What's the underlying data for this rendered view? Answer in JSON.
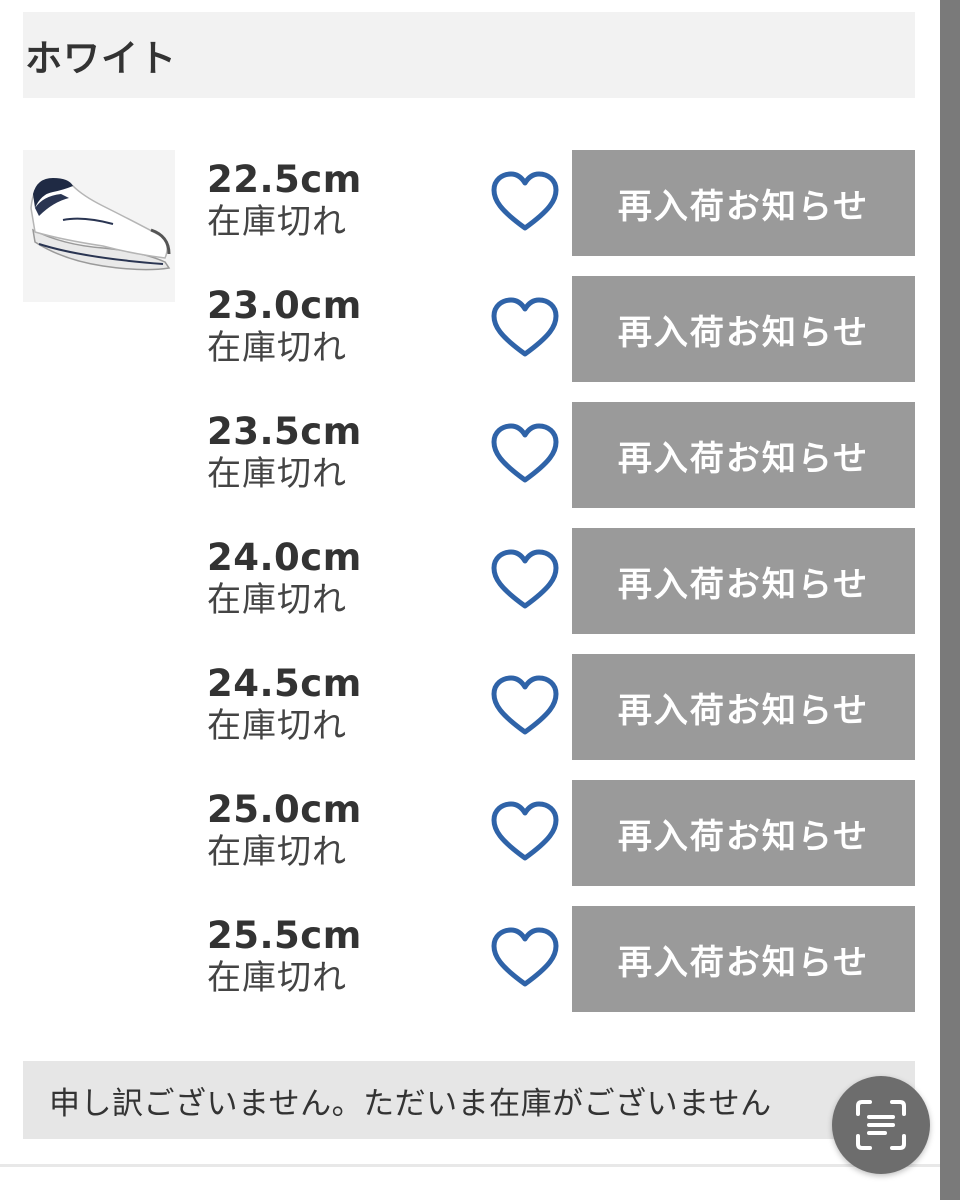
{
  "color_header": {
    "label": "ホワイト"
  },
  "product": {
    "image_icon": "sneaker-image"
  },
  "sizes": [
    {
      "size": "22.5cm",
      "stock": "在庫切れ",
      "button": "再入荷お知らせ"
    },
    {
      "size": "23.0cm",
      "stock": "在庫切れ",
      "button": "再入荷お知らせ"
    },
    {
      "size": "23.5cm",
      "stock": "在庫切れ",
      "button": "再入荷お知らせ"
    },
    {
      "size": "24.0cm",
      "stock": "在庫切れ",
      "button": "再入荷お知らせ"
    },
    {
      "size": "24.5cm",
      "stock": "在庫切れ",
      "button": "再入荷お知らせ"
    },
    {
      "size": "25.0cm",
      "stock": "在庫切れ",
      "button": "再入荷お知らせ"
    },
    {
      "size": "25.5cm",
      "stock": "在庫切れ",
      "button": "再入荷お知らせ"
    }
  ],
  "icons": {
    "favorite": "heart-outline-icon",
    "scan": "text-scan-icon"
  },
  "notice": {
    "text": "申し訳ございません。ただいま在庫がございません"
  },
  "colors": {
    "heart": "#2f63a8",
    "button_bg": "#9a9a9a",
    "header_bg": "#f2f2f2",
    "notice_bg": "#e6e6e6",
    "scrollbar": "#7a7a7a"
  }
}
